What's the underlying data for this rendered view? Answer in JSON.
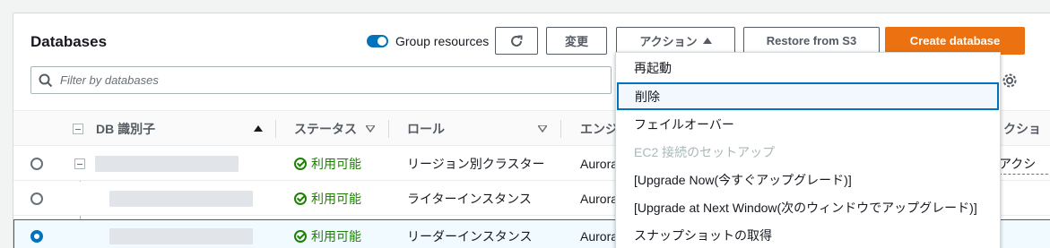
{
  "header": {
    "title": "Databases",
    "group_toggle_label": "Group resources",
    "modify_label": "変更",
    "actions_label": "アクション",
    "restore_label": "Restore from S3",
    "create_label": "Create database"
  },
  "filter": {
    "placeholder": "Filter by databases"
  },
  "table": {
    "columns": {
      "db_id": "DB 識別子",
      "status": "ステータス",
      "role": "ロール",
      "engine_partial": "エンジ",
      "actions_partial": "クショ"
    },
    "rows": [
      {
        "status": "利用可能",
        "role": "リージョン別クラスター",
        "engine": "Aurora",
        "actions_partial": "アクシ"
      },
      {
        "status": "利用可能",
        "role": "ライターインスタンス",
        "engine": "Aurora"
      },
      {
        "status": "利用可能",
        "role": "リーダーインスタンス",
        "engine": "Aurora"
      }
    ]
  },
  "menu": {
    "items": [
      {
        "label": "再起動"
      },
      {
        "label": "削除"
      },
      {
        "label": "フェイルオーバー"
      },
      {
        "label": "EC2 接続のセットアップ"
      },
      {
        "label": "[Upgrade Now(今すぐアップグレード)]"
      },
      {
        "label": "[Upgrade at Next Window(次のウィンドウでアップグレード)]"
      },
      {
        "label": "スナップショットの取得"
      }
    ]
  },
  "colors": {
    "primary": "#ec7211",
    "accent": "#0073bb",
    "available": "#1d8102"
  },
  "icons": [
    "refresh-icon",
    "caret-up-icon",
    "search-icon",
    "settings-gear-icon",
    "sort-up-icon",
    "sort-down-icon",
    "status-check-icon",
    "tree-collapse-icon"
  ]
}
